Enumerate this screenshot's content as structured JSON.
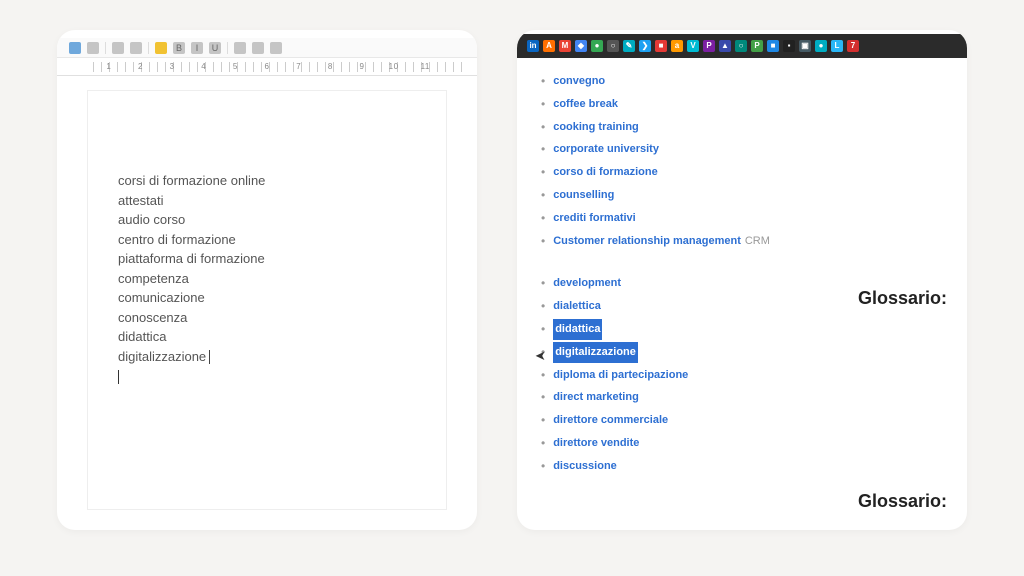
{
  "left": {
    "ruler_numbers": [
      "1",
      "2",
      "3",
      "4",
      "5",
      "6",
      "7",
      "8",
      "9",
      "10",
      "11"
    ],
    "lines": [
      "corsi di formazione online",
      "attestati",
      "audio corso",
      "centro di formazione",
      "piattaforma di formazione",
      "competenza",
      "comunicazione",
      "conoscenza",
      "didattica",
      "digitalizzazione"
    ]
  },
  "right": {
    "tabs_favicons": [
      {
        "bg": "#0a66c2",
        "txt": "in"
      },
      {
        "bg": "#ff6f00",
        "txt": "A"
      },
      {
        "bg": "#ea4335",
        "txt": "M"
      },
      {
        "bg": "#4285f4",
        "txt": "◆"
      },
      {
        "bg": "#34a853",
        "txt": "●"
      },
      {
        "bg": "#555555",
        "txt": "○"
      },
      {
        "bg": "#00acc1",
        "txt": "✎"
      },
      {
        "bg": "#1da1f2",
        "txt": "❯"
      },
      {
        "bg": "#e53935",
        "txt": "■"
      },
      {
        "bg": "#ff9900",
        "txt": "a"
      },
      {
        "bg": "#00bcd4",
        "txt": "V"
      },
      {
        "bg": "#7b1fa2",
        "txt": "P"
      },
      {
        "bg": "#3949ab",
        "txt": "▲"
      },
      {
        "bg": "#00897b",
        "txt": "○"
      },
      {
        "bg": "#43a047",
        "txt": "P"
      },
      {
        "bg": "#1e88e5",
        "txt": "■"
      },
      {
        "bg": "#212121",
        "txt": "▪"
      },
      {
        "bg": "#455a64",
        "txt": "▣"
      },
      {
        "bg": "#00acc1",
        "txt": "●"
      },
      {
        "bg": "#29b6f6",
        "txt": "L"
      },
      {
        "bg": "#d32f2f",
        "txt": "7"
      }
    ],
    "section_c": [
      {
        "label": "convegno"
      },
      {
        "label": "coffee break"
      },
      {
        "label": "cooking training"
      },
      {
        "label": "corporate university"
      },
      {
        "label": "corso di formazione"
      },
      {
        "label": "counselling"
      },
      {
        "label": "crediti formativi"
      },
      {
        "label": "Customer relationship management",
        "suffix": "CRM"
      }
    ],
    "section_d": [
      {
        "label": "development"
      },
      {
        "label": "dialettica"
      },
      {
        "label": "didattica",
        "selected": true
      },
      {
        "label": "digitalizzazione",
        "selected": true
      },
      {
        "label": "diploma di partecipazione"
      },
      {
        "label": "direct marketing"
      },
      {
        "label": "direttore commerciale"
      },
      {
        "label": "direttore vendite"
      },
      {
        "label": "discussione"
      }
    ],
    "heading": "Glossario:"
  }
}
